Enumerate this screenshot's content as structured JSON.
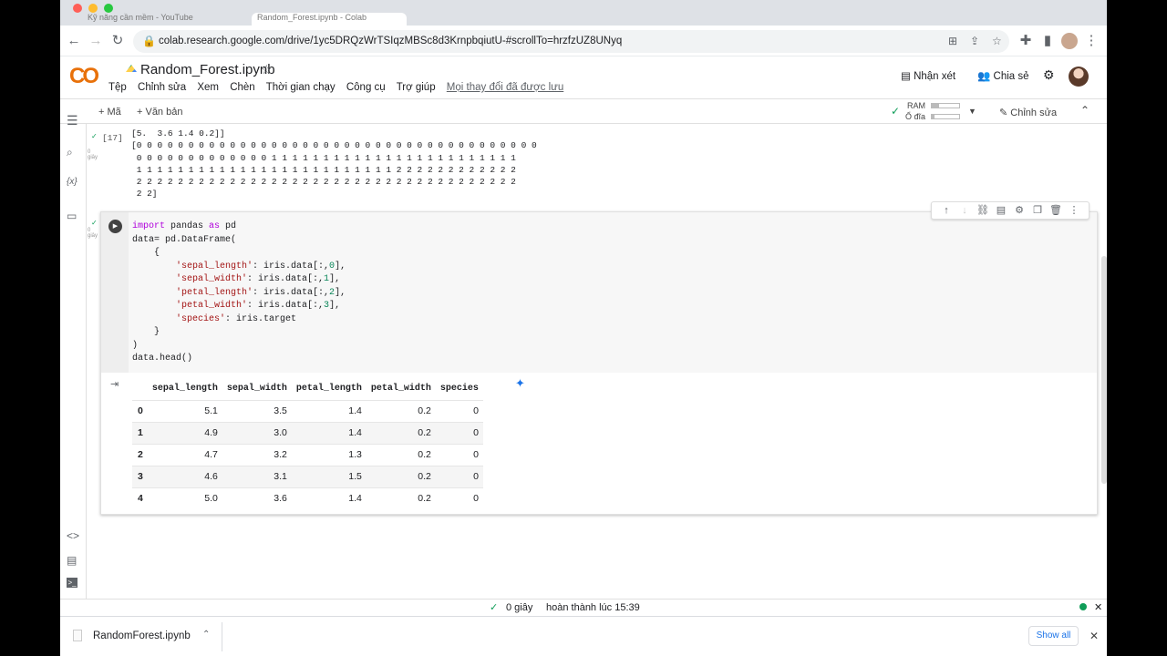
{
  "browser": {
    "tabs": [
      "Kỹ năng cần mềm - YouTube",
      "Random_Forest.ipynb - Colab"
    ],
    "url": "colab.research.google.com/drive/1yc5DRQzWrTSIqzMBSc8d3KrnpbqiutU-#scrollTo=hrzfzUZ8UNyq"
  },
  "colab": {
    "logo": "CO",
    "title": "Random_Forest.ipynb",
    "menu": [
      "Tệp",
      "Chỉnh sửa",
      "Xem",
      "Chèn",
      "Thời gian chạy",
      "Công cụ",
      "Trợ giúp"
    ],
    "saved_note": "Mọi thay đổi đã được lưu",
    "comment_label": "Nhận xét",
    "share_label": "Chia sẻ"
  },
  "toolbar": {
    "add_code": "+ Mã",
    "add_text": "+ Văn bản",
    "ram_label": "RAM",
    "disk_label": "Ổ đĩa",
    "ram_level": 0.28,
    "disk_level": 0.1,
    "edit_label": "Chỉnh sửa"
  },
  "cell17": {
    "exec_count": "[17]",
    "time": "0 giây",
    "output": "[5.  3.6 1.4 0.2]]\n[0 0 0 0 0 0 0 0 0 0 0 0 0 0 0 0 0 0 0 0 0 0 0 0 0 0 0 0 0 0 0 0 0 0 0 0 0 0 0\n 0 0 0 0 0 0 0 0 0 0 0 0 0 1 1 1 1 1 1 1 1 1 1 1 1 1 1 1 1 1 1 1 1 1 1 1 1\n 1 1 1 1 1 1 1 1 1 1 1 1 1 1 1 1 1 1 1 1 1 1 1 1 1 2 2 2 2 2 2 2 2 2 2 2 2\n 2 2 2 2 2 2 2 2 2 2 2 2 2 2 2 2 2 2 2 2 2 2 2 2 2 2 2 2 2 2 2 2 2 2 2 2 2\n 2 2]"
  },
  "cell18": {
    "time": "0 giây",
    "code_lines": [
      "import pandas as pd",
      "data= pd.DataFrame(",
      "    {",
      "        'sepal_length': iris.data[:,0],",
      "        'sepal_width': iris.data[:,1],",
      "        'petal_length': iris.data[:,2],",
      "        'petal_width': iris.data[:,3],",
      "        'species': iris.target",
      "    }",
      ")",
      "data.head()"
    ],
    "table": {
      "columns": [
        "sepal_length",
        "sepal_width",
        "petal_length",
        "petal_width",
        "species"
      ],
      "rows": [
        {
          "index": "0",
          "values": [
            "5.1",
            "3.5",
            "1.4",
            "0.2",
            "0"
          ]
        },
        {
          "index": "1",
          "values": [
            "4.9",
            "3.0",
            "1.4",
            "0.2",
            "0"
          ]
        },
        {
          "index": "2",
          "values": [
            "4.7",
            "3.2",
            "1.3",
            "0.2",
            "0"
          ]
        },
        {
          "index": "3",
          "values": [
            "4.6",
            "3.1",
            "1.5",
            "0.2",
            "0"
          ]
        },
        {
          "index": "4",
          "values": [
            "5.0",
            "3.6",
            "1.4",
            "0.2",
            "0"
          ]
        }
      ]
    }
  },
  "statusbar": {
    "duration": "0 giây",
    "completed": "hoàn thành lúc 15:39"
  },
  "downloads": {
    "file": "RandomForest.ipynb",
    "show_all": "Show all"
  },
  "colors": {
    "accent": "#1a73e8",
    "success": "#0f9d58",
    "keyword": "#af00db",
    "string": "#a31515",
    "number": "#098658"
  }
}
